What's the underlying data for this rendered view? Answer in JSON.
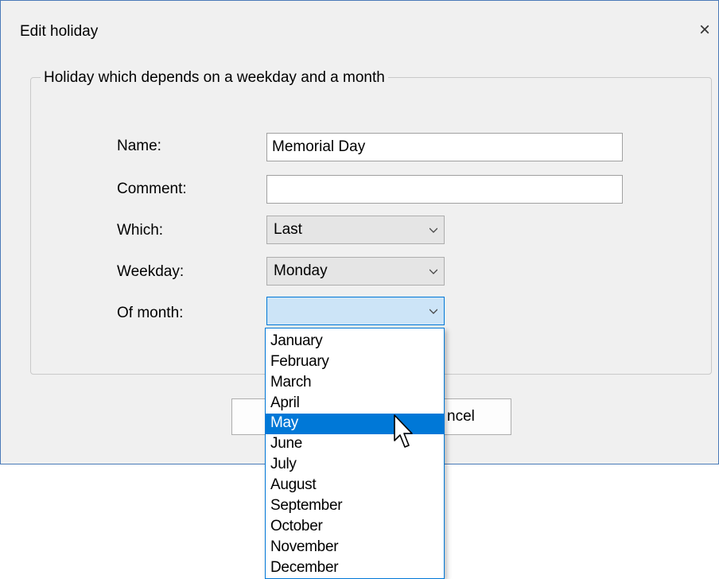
{
  "window": {
    "title": "Edit holiday",
    "close_label": "×"
  },
  "group": {
    "label": "Holiday which depends on a weekday and a month"
  },
  "form": {
    "name_label": "Name:",
    "name_value": "Memorial Day",
    "comment_label": "Comment:",
    "comment_value": "",
    "which_label": "Which:",
    "which_value": "Last",
    "weekday_label": "Weekday:",
    "weekday_value": "Monday",
    "month_label": "Of month:",
    "month_value": ""
  },
  "buttons": {
    "ok_label": "",
    "cancel_label": "ncel"
  },
  "month_options": [
    "January",
    "February",
    "March",
    "April",
    "May",
    "June",
    "July",
    "August",
    "September",
    "October",
    "November",
    "December"
  ],
  "highlighted_option": "May",
  "colors": {
    "accent": "#0078d7",
    "dialog_bg": "#f0f0f0"
  }
}
